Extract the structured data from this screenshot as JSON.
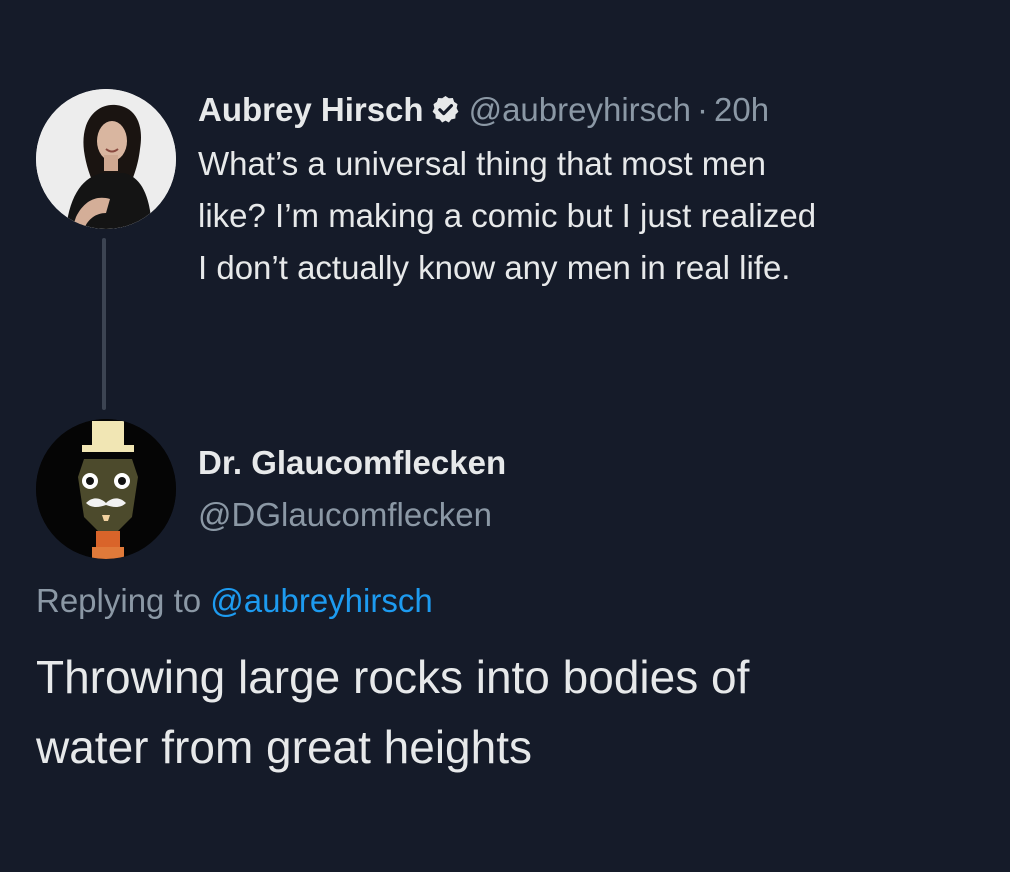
{
  "tweet": {
    "author_name": "Aubrey Hirsch",
    "author_handle": "@aubreyhirsch",
    "separator": "·",
    "time": "20h",
    "verified_icon": "verified-badge-icon",
    "text_lines": [
      "What’s a universal thing that most men",
      "like? I’m making a comic but I just realized",
      "I don’t actually know any men in real life."
    ]
  },
  "reply": {
    "author_name": "Dr. Glaucomflecken",
    "author_handle": "@DGlaucomflecken",
    "replying_prefix": "Replying to",
    "replying_to": "@aubreyhirsch",
    "text_lines": [
      "Throwing large rocks into bodies of",
      "water from great heights"
    ]
  },
  "colors": {
    "background": "#151b29",
    "text": "#e7e9ea",
    "muted": "#8b98a5",
    "link": "#1d9bf0",
    "thread_line": "#3c4452"
  }
}
